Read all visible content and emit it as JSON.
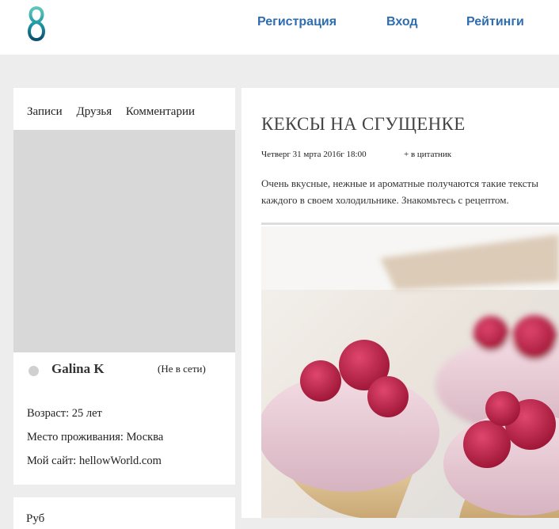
{
  "header": {
    "logo_icon": "figure-eight-logo",
    "nav": [
      {
        "label": "Регистрация"
      },
      {
        "label": "Вход"
      },
      {
        "label": "Рейтинги"
      }
    ]
  },
  "sidebar": {
    "tabs": [
      {
        "label": "Записи"
      },
      {
        "label": "Друзья"
      },
      {
        "label": "Комментарии"
      }
    ],
    "user": {
      "name": "Galina K",
      "status": "(Не в сети)",
      "age": "Возраст: 25 лет",
      "city": "Место проживания: Москва",
      "site": "Мой сайт: hellowWorld.com"
    },
    "next_block_partial": "Руб"
  },
  "post": {
    "title": "КЕКСЫ НА СГУЩЕНКЕ",
    "date": "Четверг 31 мрта 2016г 18:00",
    "quote_link": "+ в цитатник",
    "text_line1": "Очень вкусные, нежные и ароматные получаются такие тексты",
    "text_line2": "каждого в своем холодильнике. Знакомьтесь с рецептом.",
    "image": "raspberry-cupcakes-photo"
  },
  "colors": {
    "nav_link": "#2f6db0",
    "page_bg": "#ededed",
    "photo_placeholder": "#d8d8d8"
  }
}
